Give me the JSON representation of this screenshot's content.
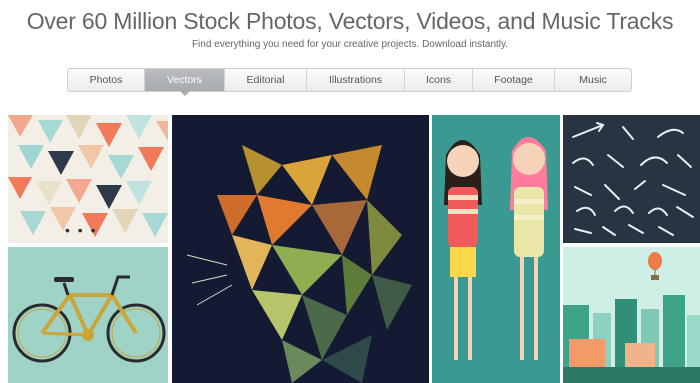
{
  "header": {
    "title": "Over 60 Million Stock Photos, Vectors, Videos, and Music Tracks",
    "subtitle": "Find everything you need for your creative projects. Download instantly."
  },
  "tabs": [
    {
      "label": "Photos",
      "active": false
    },
    {
      "label": "Vectors",
      "active": true
    },
    {
      "label": "Editorial",
      "active": false
    },
    {
      "label": "Illustrations",
      "active": false
    },
    {
      "label": "Icons",
      "active": false
    },
    {
      "label": "Footage",
      "active": false
    },
    {
      "label": "Music",
      "active": false
    }
  ],
  "tiles": {
    "triangles": {
      "name": "geometric-triangles-pattern",
      "overlay_text": "• • •"
    },
    "bicycle": {
      "name": "bicycle-illustration"
    },
    "tiger": {
      "name": "low-poly-tiger"
    },
    "girls": {
      "name": "cartoon-girls"
    },
    "arrows": {
      "name": "hand-drawn-arrows-set"
    },
    "city": {
      "name": "flat-city-skyline"
    }
  },
  "colors": {
    "tab_active": "#a7aaae",
    "tiger_bg": "#151a33",
    "girls_bg": "#3a9a91",
    "arrows_bg": "#263541",
    "bicycle_bg": "#9fd3c7",
    "city_sky": "#cfeee6"
  }
}
